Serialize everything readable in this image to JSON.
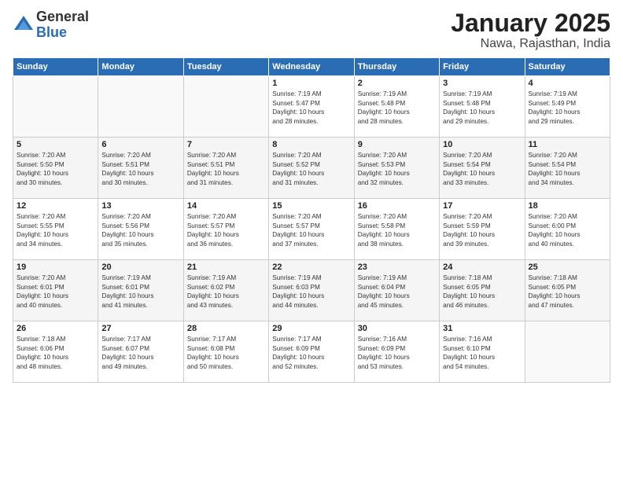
{
  "logo": {
    "general": "General",
    "blue": "Blue"
  },
  "title": "January 2025",
  "subtitle": "Nawa, Rajasthan, India",
  "headers": [
    "Sunday",
    "Monday",
    "Tuesday",
    "Wednesday",
    "Thursday",
    "Friday",
    "Saturday"
  ],
  "rows": [
    [
      {
        "day": "",
        "info": ""
      },
      {
        "day": "",
        "info": ""
      },
      {
        "day": "",
        "info": ""
      },
      {
        "day": "1",
        "info": "Sunrise: 7:19 AM\nSunset: 5:47 PM\nDaylight: 10 hours\nand 28 minutes."
      },
      {
        "day": "2",
        "info": "Sunrise: 7:19 AM\nSunset: 5:48 PM\nDaylight: 10 hours\nand 28 minutes."
      },
      {
        "day": "3",
        "info": "Sunrise: 7:19 AM\nSunset: 5:48 PM\nDaylight: 10 hours\nand 29 minutes."
      },
      {
        "day": "4",
        "info": "Sunrise: 7:19 AM\nSunset: 5:49 PM\nDaylight: 10 hours\nand 29 minutes."
      }
    ],
    [
      {
        "day": "5",
        "info": "Sunrise: 7:20 AM\nSunset: 5:50 PM\nDaylight: 10 hours\nand 30 minutes."
      },
      {
        "day": "6",
        "info": "Sunrise: 7:20 AM\nSunset: 5:51 PM\nDaylight: 10 hours\nand 30 minutes."
      },
      {
        "day": "7",
        "info": "Sunrise: 7:20 AM\nSunset: 5:51 PM\nDaylight: 10 hours\nand 31 minutes."
      },
      {
        "day": "8",
        "info": "Sunrise: 7:20 AM\nSunset: 5:52 PM\nDaylight: 10 hours\nand 31 minutes."
      },
      {
        "day": "9",
        "info": "Sunrise: 7:20 AM\nSunset: 5:53 PM\nDaylight: 10 hours\nand 32 minutes."
      },
      {
        "day": "10",
        "info": "Sunrise: 7:20 AM\nSunset: 5:54 PM\nDaylight: 10 hours\nand 33 minutes."
      },
      {
        "day": "11",
        "info": "Sunrise: 7:20 AM\nSunset: 5:54 PM\nDaylight: 10 hours\nand 34 minutes."
      }
    ],
    [
      {
        "day": "12",
        "info": "Sunrise: 7:20 AM\nSunset: 5:55 PM\nDaylight: 10 hours\nand 34 minutes."
      },
      {
        "day": "13",
        "info": "Sunrise: 7:20 AM\nSunset: 5:56 PM\nDaylight: 10 hours\nand 35 minutes."
      },
      {
        "day": "14",
        "info": "Sunrise: 7:20 AM\nSunset: 5:57 PM\nDaylight: 10 hours\nand 36 minutes."
      },
      {
        "day": "15",
        "info": "Sunrise: 7:20 AM\nSunset: 5:57 PM\nDaylight: 10 hours\nand 37 minutes."
      },
      {
        "day": "16",
        "info": "Sunrise: 7:20 AM\nSunset: 5:58 PM\nDaylight: 10 hours\nand 38 minutes."
      },
      {
        "day": "17",
        "info": "Sunrise: 7:20 AM\nSunset: 5:59 PM\nDaylight: 10 hours\nand 39 minutes."
      },
      {
        "day": "18",
        "info": "Sunrise: 7:20 AM\nSunset: 6:00 PM\nDaylight: 10 hours\nand 40 minutes."
      }
    ],
    [
      {
        "day": "19",
        "info": "Sunrise: 7:20 AM\nSunset: 6:01 PM\nDaylight: 10 hours\nand 40 minutes."
      },
      {
        "day": "20",
        "info": "Sunrise: 7:19 AM\nSunset: 6:01 PM\nDaylight: 10 hours\nand 41 minutes."
      },
      {
        "day": "21",
        "info": "Sunrise: 7:19 AM\nSunset: 6:02 PM\nDaylight: 10 hours\nand 43 minutes."
      },
      {
        "day": "22",
        "info": "Sunrise: 7:19 AM\nSunset: 6:03 PM\nDaylight: 10 hours\nand 44 minutes."
      },
      {
        "day": "23",
        "info": "Sunrise: 7:19 AM\nSunset: 6:04 PM\nDaylight: 10 hours\nand 45 minutes."
      },
      {
        "day": "24",
        "info": "Sunrise: 7:18 AM\nSunset: 6:05 PM\nDaylight: 10 hours\nand 46 minutes."
      },
      {
        "day": "25",
        "info": "Sunrise: 7:18 AM\nSunset: 6:05 PM\nDaylight: 10 hours\nand 47 minutes."
      }
    ],
    [
      {
        "day": "26",
        "info": "Sunrise: 7:18 AM\nSunset: 6:06 PM\nDaylight: 10 hours\nand 48 minutes."
      },
      {
        "day": "27",
        "info": "Sunrise: 7:17 AM\nSunset: 6:07 PM\nDaylight: 10 hours\nand 49 minutes."
      },
      {
        "day": "28",
        "info": "Sunrise: 7:17 AM\nSunset: 6:08 PM\nDaylight: 10 hours\nand 50 minutes."
      },
      {
        "day": "29",
        "info": "Sunrise: 7:17 AM\nSunset: 6:09 PM\nDaylight: 10 hours\nand 52 minutes."
      },
      {
        "day": "30",
        "info": "Sunrise: 7:16 AM\nSunset: 6:09 PM\nDaylight: 10 hours\nand 53 minutes."
      },
      {
        "day": "31",
        "info": "Sunrise: 7:16 AM\nSunset: 6:10 PM\nDaylight: 10 hours\nand 54 minutes."
      },
      {
        "day": "",
        "info": ""
      }
    ]
  ]
}
